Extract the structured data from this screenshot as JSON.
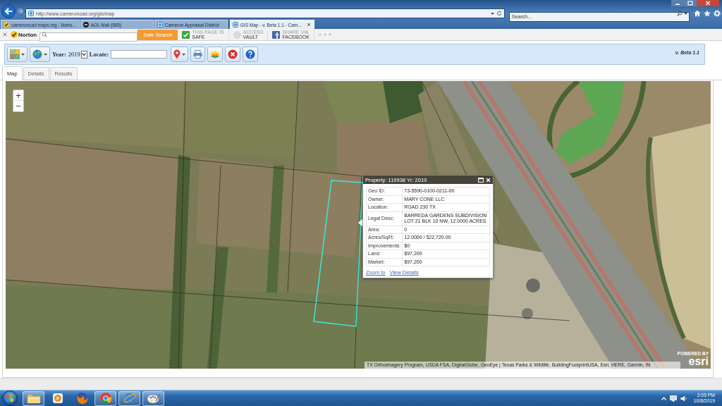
{
  "browser": {
    "address": "http://www.cameroncad.org/gis/map",
    "search": {
      "placeholder": "Search..."
    },
    "tabs": [
      {
        "kind": "check",
        "label": "cameroncad maps.org - Norto...",
        "selected": false
      },
      {
        "kind": "badge",
        "label": "AOL Mail (585)",
        "selected": false
      },
      {
        "kind": "page",
        "label": "Cameron Appraisal District",
        "selected": false
      },
      {
        "kind": "page",
        "label": "GIS Map - v. Beta 1.1 - Cam...",
        "selected": true
      }
    ]
  },
  "norton_toolbar": {
    "logo": "Norton",
    "search_button": "Safe Search",
    "items": [
      {
        "kind": "check",
        "lines": [
          "THIS PAGE IS",
          "SAFE"
        ]
      },
      {
        "kind": "gear",
        "lines": [
          "ACCESS",
          "VAULT"
        ]
      },
      {
        "kind": "square",
        "lines": [
          "SHARE VIA",
          "FACEBOOK"
        ]
      }
    ]
  },
  "app": {
    "toolbar": {
      "year_label": "Year:",
      "year": "2019",
      "locate_label": "Locate:",
      "version": "v. Beta 1.1"
    },
    "tabs": [
      {
        "label": "Map",
        "selected": true
      },
      {
        "label": "Details",
        "selected": false
      },
      {
        "label": "Results",
        "selected": false
      }
    ]
  },
  "map": {
    "zoom": [
      "+",
      "−"
    ],
    "popup": {
      "title": "Property: 119938 Yr: 2019",
      "rows": [
        {
          "label": "Geo ID:",
          "value": "73-5590-0100-0211-00"
        },
        {
          "label": "Owner:",
          "value": "MARY CONE LLC"
        },
        {
          "label": "Location:",
          "value": "ROAD 230 TX"
        },
        {
          "label": "Legal Desc:",
          "value": "BARREDA GARDENS SUBDIVISION LOT 21 BLK 10 NW, 12.0000 ACRES"
        },
        {
          "label": "Area:",
          "value": "0"
        },
        {
          "label": "Acres/SqFt:",
          "value": "12.0000 / 522,720.00"
        },
        {
          "label": "Improvements:",
          "value": "$0"
        },
        {
          "label": "Land:",
          "value": "$97,200"
        },
        {
          "label": "Market:",
          "value": "$97,200"
        }
      ],
      "links": [
        "Zoom to",
        "View Details"
      ]
    },
    "attribution": "TX Orthoimagery Program, USDA FSA, DigitalGlobe, GeoEye | Texas Parks & Wildlife, BuildingFootprintUSA, Esri, HERE, Garmin, IN",
    "logo": {
      "tagline": "POWERED BY",
      "wordmark": "esri"
    }
  },
  "taskbar": {
    "apps": [
      {
        "kind": "folder",
        "running": true
      },
      {
        "kind": "player",
        "running": false
      },
      {
        "kind": "fox",
        "running": false
      },
      {
        "kind": "segmented",
        "running": true
      },
      {
        "kind": "orbit",
        "running": true
      },
      {
        "kind": "palette",
        "running": true
      }
    ],
    "time": "2:05 PM",
    "date": "10/8/2019"
  }
}
